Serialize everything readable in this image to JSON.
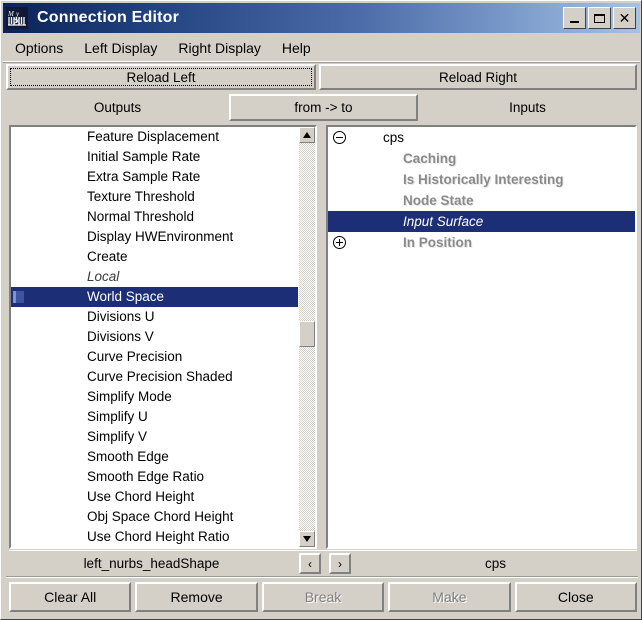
{
  "window": {
    "title": "Connection Editor",
    "icon": "maya-logo-icon",
    "controls": {
      "minimize": "minimize-icon",
      "maximize": "maximize-icon",
      "close": "close-icon"
    }
  },
  "menubar": {
    "items": [
      {
        "label": "Options"
      },
      {
        "label": "Left Display"
      },
      {
        "label": "Right Display"
      },
      {
        "label": "Help"
      }
    ]
  },
  "toolbar": {
    "reload_left": "Reload Left",
    "reload_right": "Reload Right"
  },
  "headers": {
    "outputs": "Outputs",
    "from_to": "from -> to",
    "inputs": "Inputs"
  },
  "left_panel": {
    "items": [
      {
        "label": "Feature Displacement",
        "style": "normal",
        "selected": false
      },
      {
        "label": "Initial Sample Rate",
        "style": "normal",
        "selected": false
      },
      {
        "label": "Extra Sample Rate",
        "style": "normal",
        "selected": false
      },
      {
        "label": "Texture Threshold",
        "style": "normal",
        "selected": false
      },
      {
        "label": "Normal Threshold",
        "style": "normal",
        "selected": false
      },
      {
        "label": "Display HWEnvironment",
        "style": "normal",
        "selected": false
      },
      {
        "label": "Create",
        "style": "normal",
        "selected": false
      },
      {
        "label": "Local",
        "style": "italic",
        "selected": false
      },
      {
        "label": "World Space",
        "style": "normal",
        "selected": true
      },
      {
        "label": "Divisions U",
        "style": "normal",
        "selected": false
      },
      {
        "label": "Divisions V",
        "style": "normal",
        "selected": false
      },
      {
        "label": "Curve Precision",
        "style": "normal",
        "selected": false
      },
      {
        "label": "Curve Precision Shaded",
        "style": "normal",
        "selected": false
      },
      {
        "label": "Simplify Mode",
        "style": "normal",
        "selected": false
      },
      {
        "label": "Simplify U",
        "style": "normal",
        "selected": false
      },
      {
        "label": "Simplify V",
        "style": "normal",
        "selected": false
      },
      {
        "label": "Smooth Edge",
        "style": "normal",
        "selected": false
      },
      {
        "label": "Smooth Edge Ratio",
        "style": "normal",
        "selected": false
      },
      {
        "label": "Use Chord Height",
        "style": "normal",
        "selected": false
      },
      {
        "label": "Obj Space Chord Height",
        "style": "normal",
        "selected": false
      },
      {
        "label": "Use Chord Height Ratio",
        "style": "normal",
        "selected": false
      }
    ],
    "scrollbar": {
      "up_icon": "scroll-up-arrow-icon",
      "down_icon": "scroll-down-arrow-icon"
    }
  },
  "right_panel": {
    "items": [
      {
        "label": "cps",
        "level": "root",
        "expander": "minus",
        "selected": false
      },
      {
        "label": "Caching",
        "level": "child",
        "expander": "none",
        "selected": false
      },
      {
        "label": "Is Historically Interesting",
        "level": "child",
        "expander": "none",
        "selected": false
      },
      {
        "label": "Node State",
        "level": "child",
        "expander": "none",
        "selected": false
      },
      {
        "label": "Input Surface",
        "level": "child",
        "expander": "none",
        "selected": true
      },
      {
        "label": "In Position",
        "level": "child",
        "expander": "plus",
        "selected": false
      }
    ]
  },
  "status": {
    "left_node": "left_nurbs_headShape",
    "right_node": "cps",
    "prev_label": "‹",
    "next_label": "›"
  },
  "footer": {
    "buttons": [
      {
        "label": "Clear All",
        "disabled": false
      },
      {
        "label": "Remove",
        "disabled": false
      },
      {
        "label": "Break",
        "disabled": true
      },
      {
        "label": "Make",
        "disabled": true
      },
      {
        "label": "Close",
        "disabled": false
      }
    ]
  },
  "colors": {
    "selection": "#1c2e76",
    "face": "#d4d0c8",
    "title_start": "#0b2357",
    "title_end": "#a8c2e2"
  }
}
